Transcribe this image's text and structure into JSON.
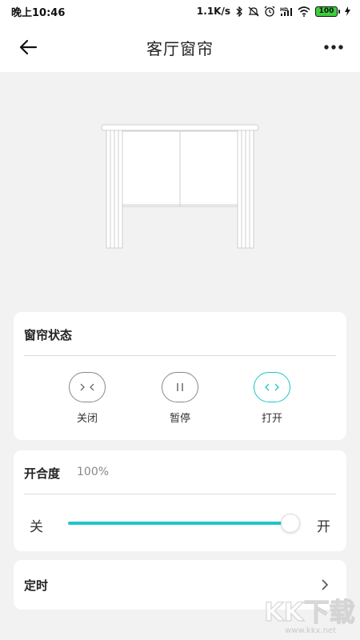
{
  "status_bar": {
    "time": "晚上10:46",
    "network_speed": "1.1K/s",
    "battery": "100",
    "icons": [
      "bluetooth-icon",
      "mute-icon",
      "alarm-icon",
      "hd-signal-icon",
      "wifi-icon",
      "battery-icon",
      "charging-icon"
    ]
  },
  "header": {
    "title": "客厅窗帘",
    "back_icon": "arrow-left-icon",
    "more_icon": "more-dots-icon"
  },
  "curtain_status": {
    "title": "窗帘状态",
    "controls": [
      {
        "label": "关闭",
        "icon": "close-curtain-icon",
        "active": false
      },
      {
        "label": "暂停",
        "icon": "pause-icon",
        "active": false
      },
      {
        "label": "打开",
        "icon": "open-curtain-icon",
        "active": true
      }
    ]
  },
  "opening": {
    "title": "开合度",
    "value_text": "100%",
    "value": 100,
    "min_label": "关",
    "max_label": "开"
  },
  "timer": {
    "title": "定时",
    "chevron_icon": "chevron-right-icon"
  },
  "watermark": {
    "text": "KK下载",
    "url": "www.kkx.net"
  },
  "colors": {
    "accent": "#20c5c7",
    "background": "#f2f2f2",
    "card": "#ffffff",
    "text": "#222222",
    "muted": "#888888"
  }
}
